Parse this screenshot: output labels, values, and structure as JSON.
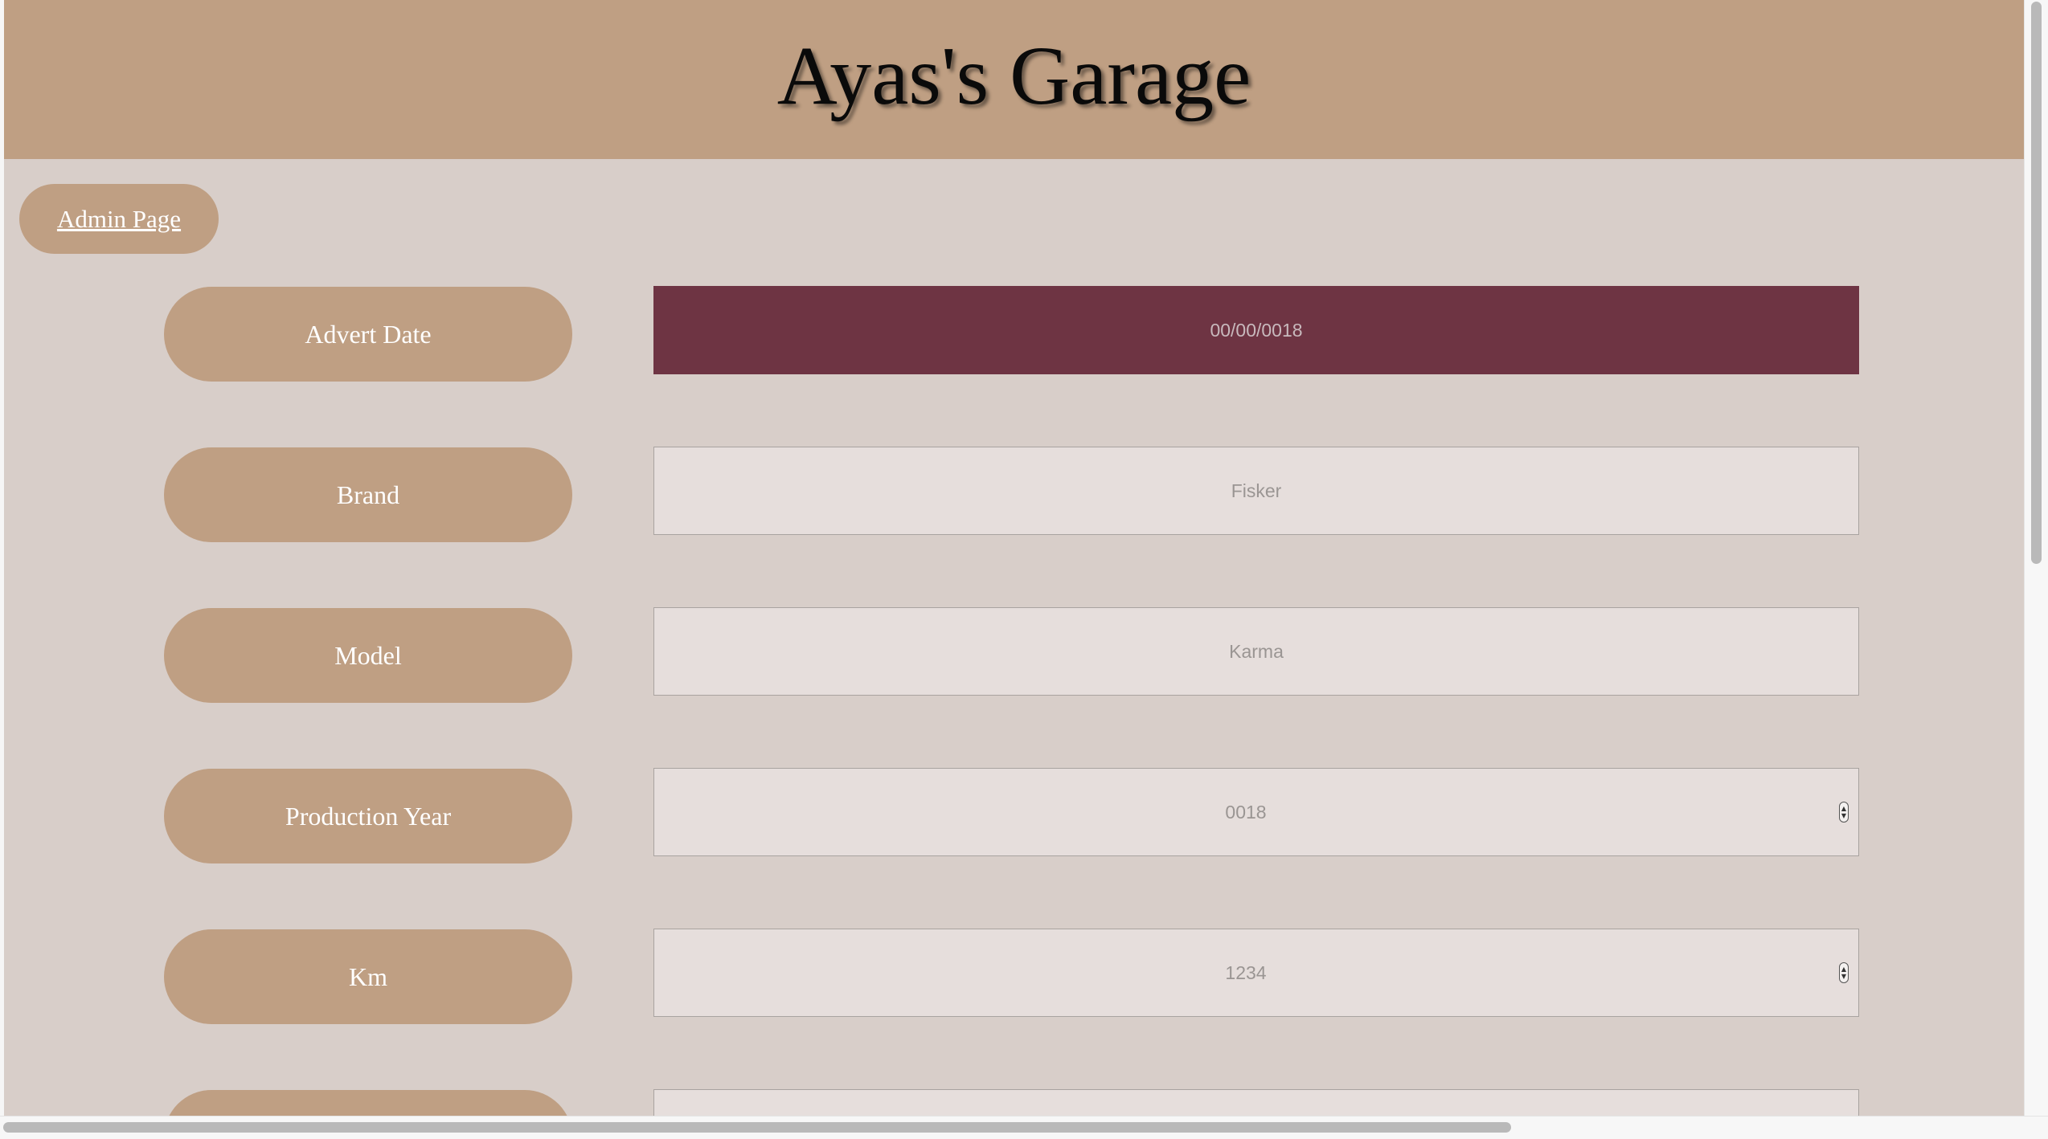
{
  "header": {
    "title": "Ayas's Garage"
  },
  "nav": {
    "admin_link": "Admin Page"
  },
  "form": {
    "fields": [
      {
        "label": "Advert Date",
        "value": "00/00/0018"
      },
      {
        "label": "Brand",
        "value": "Fisker"
      },
      {
        "label": "Model",
        "value": "Karma"
      },
      {
        "label": "Production Year",
        "value": "0018"
      },
      {
        "label": "Km",
        "value": "1234"
      }
    ]
  },
  "colors": {
    "header_bg": "#bf9f83",
    "page_bg": "#d8cec9",
    "pill_bg": "#bf9f83",
    "field_bg": "#e6dedc",
    "active_field_bg": "#6e3443"
  },
  "icons": {
    "spinner": "number-spinner-icon"
  }
}
